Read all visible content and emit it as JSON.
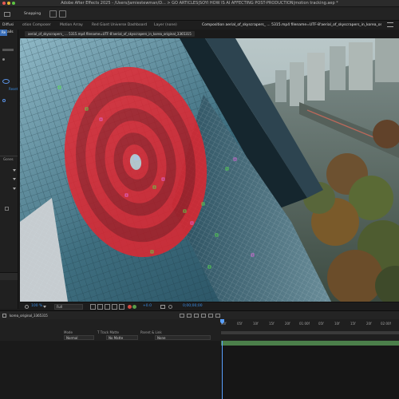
{
  "app": {
    "title": "Adobe After Effects 2025 - /Users/jamiestewman/D... > GO ARTICLES|SOYI HOW IS AI AFFECTING POST-PRODUCTION|motion tracking.aep *"
  },
  "toolbar": {
    "snapping_label": "Snapping"
  },
  "panel_tabs": {
    "effects_tab": "Diffusi",
    "composer_tab": "otion Composer 3",
    "motion_array_tab": "Motion Array",
    "red_giant_tab": "Red Giant Universe Dashboard",
    "layer_tab": "Layer (none)",
    "composition_tab": "Composition aerial_of_skyscrapers_ ... 5315.mp4 filename=UTF-8'aerial_of_skyscrapers_in_korea_original_3365315",
    "menu_icon": "hamburger-menu-icon"
  },
  "viewer": {
    "comp_tab_label": "aerial_of_skyscrapers_ ... 5315.mp4 filename=UTF-8'aerial_of_skyscrapers_in_korea_original_3365315",
    "accent": "#e7242e"
  },
  "left_panel": {
    "items": [
      "Re",
      "ails",
      "Reset",
      "Gones"
    ]
  },
  "viewer_bar": {
    "zoom": "100",
    "zoom_unit": "%",
    "quality": "Full",
    "exposure": "+0.0",
    "timecode": "0;00;00;00"
  },
  "timeline": {
    "layer_name": "korea_original_3365315",
    "timecode_ticks": [
      "00f",
      "05f",
      "10f",
      "15f",
      "20f",
      "01:00f",
      "05f",
      "10f",
      "15f",
      "20f",
      "02:00f"
    ],
    "columns": {
      "mode": "Mode",
      "trkmat": "T  Track Matte",
      "parent": "Parent & Link"
    },
    "row": {
      "mode_value": "Normal",
      "matte_value": "No Matte",
      "parent_value": "None"
    }
  },
  "colors": {
    "accent_blue": "#3a8ee6",
    "target_red": "#e7242e",
    "playhead_blue": "#5aa0ff"
  }
}
